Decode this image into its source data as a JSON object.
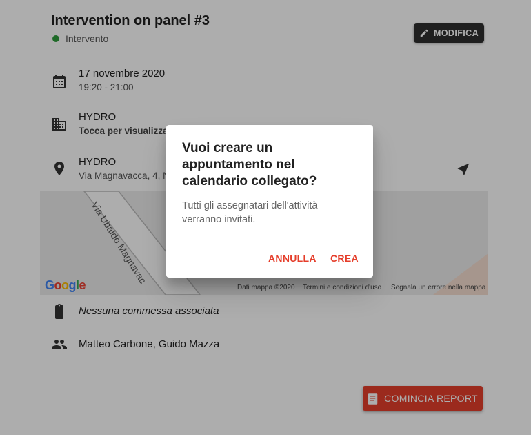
{
  "header": {
    "title": "Intervention on panel #3",
    "status_label": "Intervento",
    "status_color": "#2e9d3c",
    "edit_label": "MODIFICA",
    "edit_icon": "pencil-icon"
  },
  "details": {
    "date": {
      "icon": "calendar-icon",
      "primary": "17 novembre 2020",
      "secondary": "19:20 - 21:00"
    },
    "client": {
      "icon": "building-icon",
      "primary": "HYDRO",
      "secondary": "Tocca per visualizza"
    },
    "location": {
      "icon": "pin-icon",
      "primary": "HYDRO",
      "secondary": "Via Magnavacca, 4, N",
      "nav_icon": "navigation-arrow-icon"
    },
    "map": {
      "street_label": "Via Ubaldo Magnavac",
      "brand": [
        "G",
        "o",
        "o",
        "g",
        "l",
        "e"
      ],
      "credits": {
        "data": "Dati mappa ©2020",
        "terms": "Termini e condizioni d'uso",
        "report": "Segnala un errore nella mappa"
      }
    },
    "order": {
      "icon": "clipboard-icon",
      "primary": "Nessuna commessa associata"
    },
    "assignees": {
      "icon": "people-icon",
      "primary": "Matteo Carbone, Guido Mazza"
    }
  },
  "report_button": {
    "label": "COMINCIA REPORT",
    "icon": "document-icon"
  },
  "dialog": {
    "title": "Vuoi creare un appuntamento nel calendario collegato?",
    "body": "Tutti gli assegnatari dell'attività verranno invitati.",
    "cancel_label": "ANNULLA",
    "confirm_label": "CREA"
  },
  "colors": {
    "accent": "#e53e2b",
    "dark_button": "#2f2f2f"
  }
}
